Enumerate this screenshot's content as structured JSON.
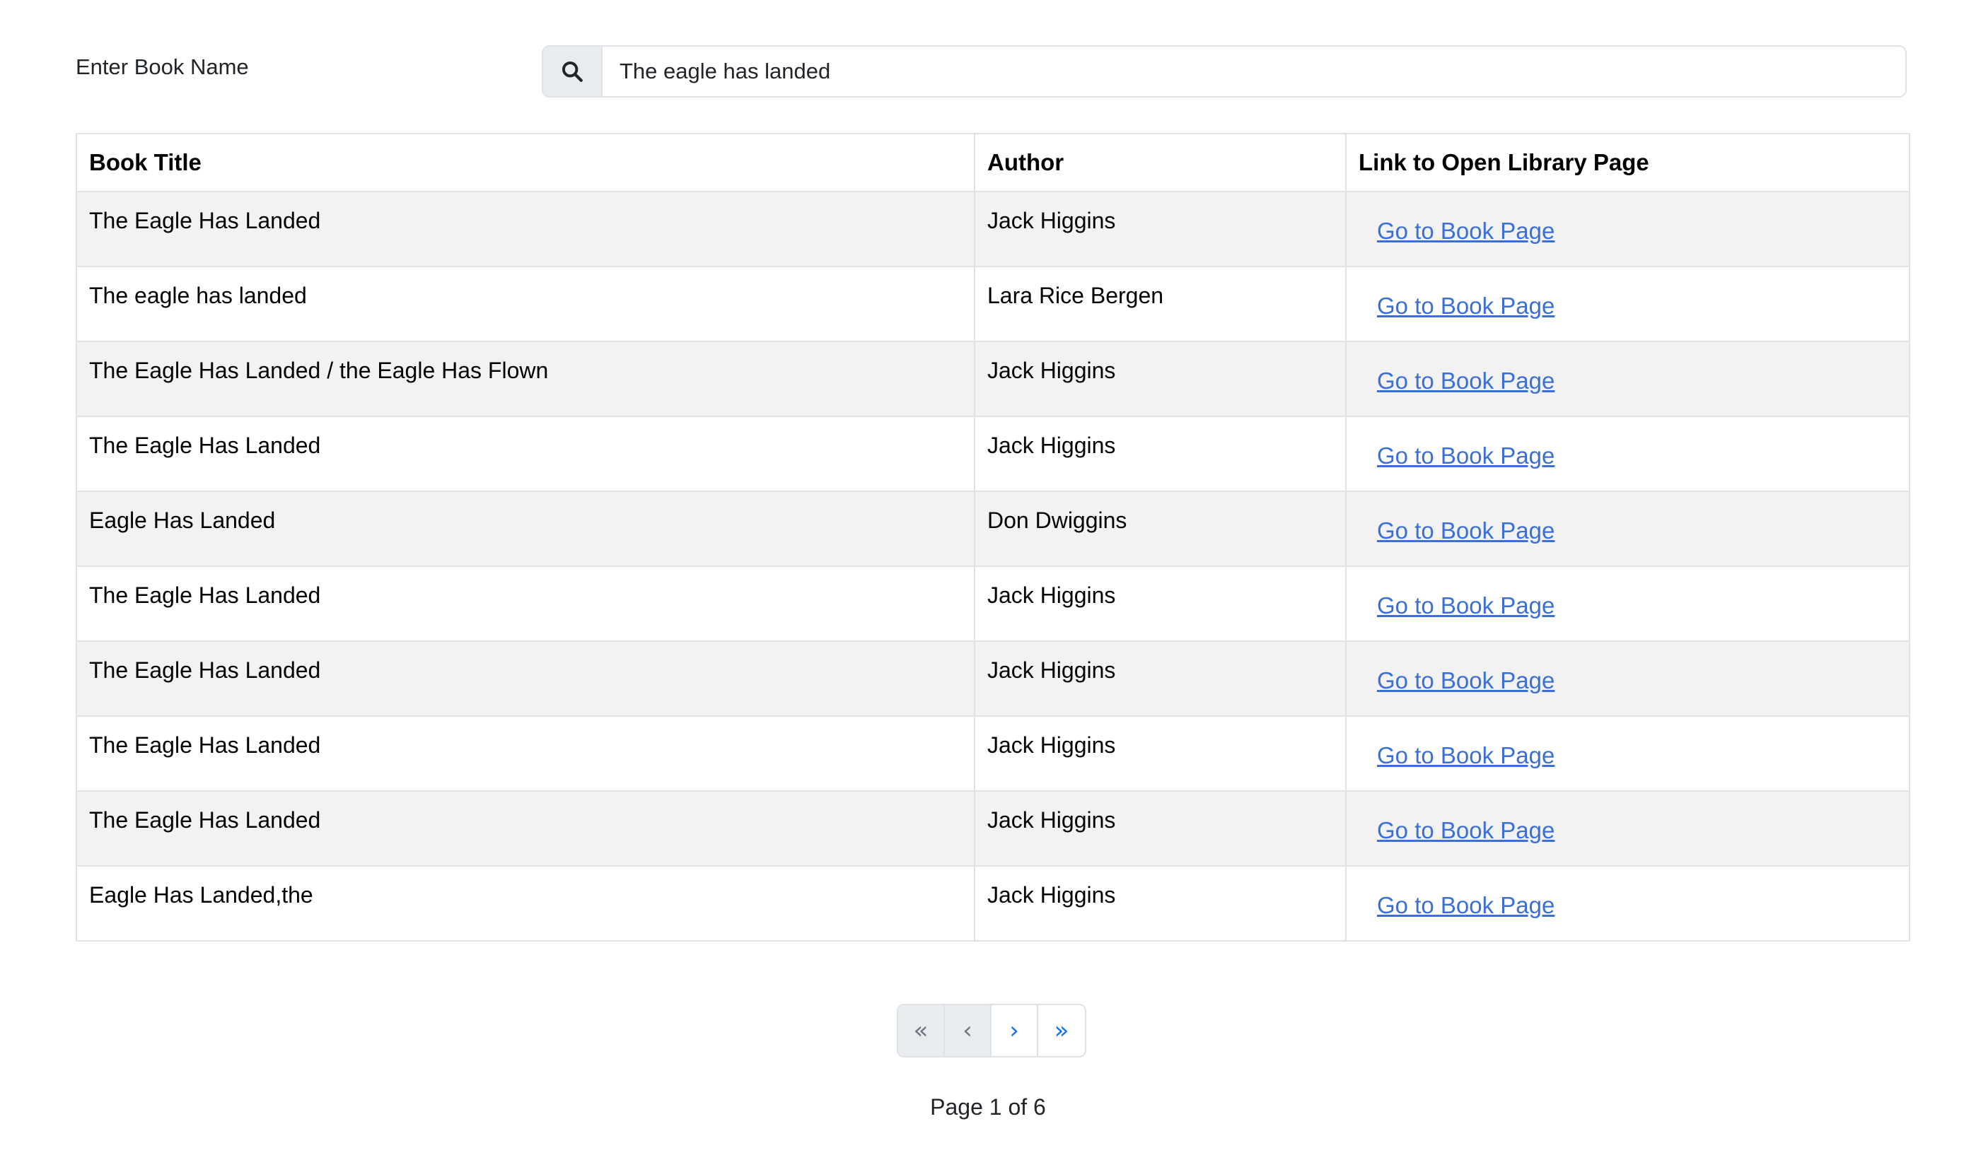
{
  "search": {
    "label": "Enter Book Name",
    "value": "The eagle has landed",
    "icon": "search-icon"
  },
  "table": {
    "headers": {
      "title": "Book Title",
      "author": "Author",
      "link": "Link to Open Library Page"
    },
    "rows": [
      {
        "title": "The Eagle Has Landed",
        "author": "Jack Higgins",
        "link": "Go to Book Page"
      },
      {
        "title": "The eagle has landed",
        "author": "Lara Rice Bergen",
        "link": "Go to Book Page"
      },
      {
        "title": "The Eagle Has Landed / the Eagle Has Flown",
        "author": "Jack Higgins",
        "link": "Go to Book Page"
      },
      {
        "title": "The Eagle Has Landed",
        "author": "Jack Higgins",
        "link": "Go to Book Page"
      },
      {
        "title": "Eagle Has Landed",
        "author": "Don Dwiggins",
        "link": "Go to Book Page"
      },
      {
        "title": "The Eagle Has Landed",
        "author": "Jack Higgins",
        "link": "Go to Book Page"
      },
      {
        "title": "The Eagle Has Landed",
        "author": "Jack Higgins",
        "link": "Go to Book Page"
      },
      {
        "title": "The Eagle Has Landed",
        "author": "Jack Higgins",
        "link": "Go to Book Page"
      },
      {
        "title": "The Eagle Has Landed",
        "author": "Jack Higgins",
        "link": "Go to Book Page"
      },
      {
        "title": "Eagle Has Landed,the",
        "author": "Jack Higgins",
        "link": "Go to Book Page"
      }
    ]
  },
  "pagination": {
    "first": "«",
    "prev": "‹",
    "next": "›",
    "last": "»"
  },
  "page_info": "Page 1 of 6",
  "colors": {
    "link": "#3b6fd8",
    "active_pager": "#0d6efd",
    "disabled_pager_bg": "#e9ecef",
    "stripe": "#f2f2f2",
    "border": "#dee2e6"
  }
}
